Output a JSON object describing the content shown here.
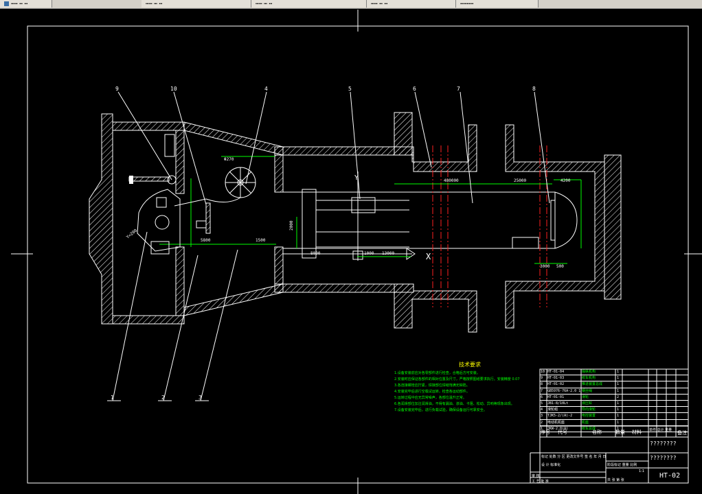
{
  "app_tabs": [
    {
      "label": "┅┅ ┅ ┅",
      "icon": "document-icon"
    },
    {
      "label": "┅┅ ┅ ┅"
    },
    {
      "label": "┅┅ ┅ ┅"
    },
    {
      "label": "┅┅ ┅ ┅"
    },
    {
      "label": "┅┅┅┅"
    }
  ],
  "balloons": [
    "9",
    "10",
    "4",
    "5",
    "6",
    "7",
    "8",
    "1",
    "2",
    "3"
  ],
  "dimensions": {
    "d_270": "Φ270",
    "d_5800": "5800",
    "d_1500": "1500",
    "d_2000": "2000",
    "d_8000": "8000",
    "d_1000": "1000",
    "d_6000_small": "6000",
    "d_13000": "13000",
    "d_480000": "480000",
    "d_25000": "25000",
    "d_4200": "4200",
    "d_3000": "3000",
    "d_500": "500",
    "d_angle": "Y=200"
  },
  "axis_labels": {
    "y": "Y",
    "x": "X"
  },
  "notes": {
    "title": "技术要求",
    "lines": [
      "1.设备安装前应对各零部件进行检查，合格后方可安装。",
      "2.安装时应保证各部件的相对位置及尺寸，严格按照图纸要求执行。安装精度 0.07",
      "3.各连接螺栓应拧紧，焊接部位焊缝饱满无缺陷。",
      "4.安装完毕后进行空载试运转，检查各运动部件。",
      "5.运转过程中应无异常噪声，各部位温升正常。",
      "6.各润滑部位加注润滑油，不得有漏油、渗油、卡阻、松动、异响等现象出现。",
      "7.设备安装完毕后，进行负载试验，确保设备运行可靠安全。"
    ]
  },
  "bom": [
    {
      "no": "10",
      "code": "HT-01-04",
      "name": "操纵机构",
      "qty": "1"
    },
    {
      "no": "9",
      "code": "HT-01-03",
      "name": "绞车机构",
      "qty": "1"
    },
    {
      "no": "8",
      "code": "HT-01-02",
      "name": "推进装置总成",
      "qty": "1"
    },
    {
      "no": "7",
      "code": "GB5976-76A-2.0 11-6",
      "name": "钢丝绳",
      "qty": "1"
    },
    {
      "no": "6",
      "code": "HT-01-01",
      "name": "滑轮",
      "qty": "2"
    },
    {
      "no": "5",
      "code": "JB1-8/10Lt",
      "name": "液压缸",
      "qty": "1"
    },
    {
      "no": "4",
      "code": "滑轮组",
      "name": "导向滑轮",
      "qty": "1"
    },
    {
      "no": "3",
      "code": "TJK5-2/(A)-2",
      "name": "电控装置",
      "qty": "1"
    },
    {
      "no": "2",
      "code": "电动机机座",
      "name": "机座",
      "qty": "1"
    },
    {
      "no": "1",
      "code": "JKW-2.0(A)",
      "name": "绞车总成",
      "qty": "1"
    }
  ],
  "bom_header": {
    "no": "序号",
    "code": "代号",
    "name": "名称",
    "qty": "数量",
    "material": "材料",
    "weight": "单件 总计 重量",
    "remark": "备注"
  },
  "title_block": {
    "school": "????????",
    "title": "????????",
    "drawing_no": "HT-02",
    "scale": "1:1",
    "rows": [
      "标记 处数 分 区 更改文件号 签 名 年 月 日",
      "设 计 标准化",
      "审 核",
      "工 艺 批 准"
    ],
    "stage_labels": "阶段标记 重量 比例",
    "sheet": "共 张 第 张"
  }
}
